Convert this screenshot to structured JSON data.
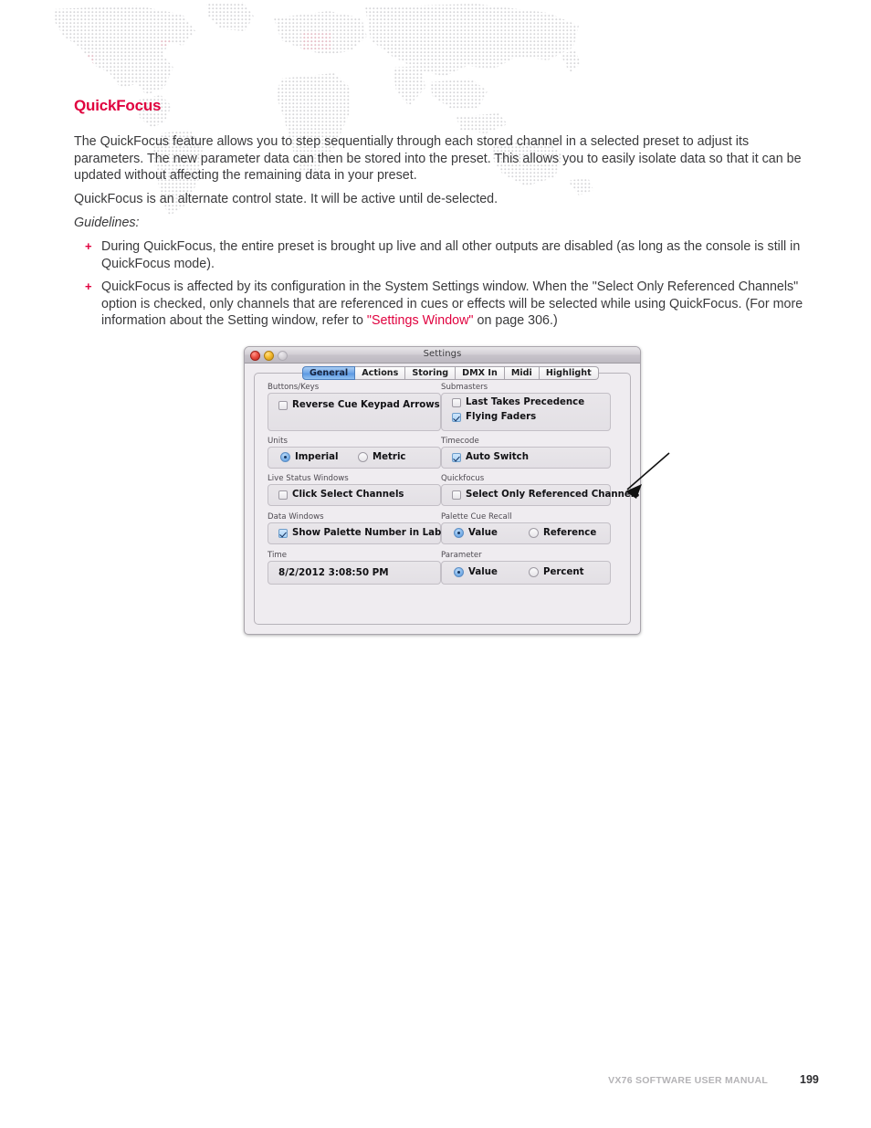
{
  "document": {
    "heading": "QuickFocus",
    "heading_color": "#e0023f",
    "paragraphs": [
      "The QuickFocus feature allows you to step sequentially through each stored channel in a selected preset to adjust its parameters. The new parameter data can then be stored into the preset. This allows you to easily isolate data so that it can be updated without affecting the remaining data in your preset.",
      "QuickFocus is an alternate control state. It will be active until de-selected."
    ],
    "guidelines_label": "Guidelines:",
    "bullet_marker": "+",
    "bullets": [
      {
        "text": "During QuickFocus, the entire preset is brought up live and all other outputs are disabled (as long as the console is still in QuickFocus mode)."
      },
      {
        "text_before": "QuickFocus is affected by its configuration in the System Settings window. When the \"Select Only Referenced Channels\" option is checked, only channels that are referenced in cues or effects will be selected while using QuickFocus. (For more information about the Setting window, refer to ",
        "link": "\"Settings Window\"",
        "text_after": " on page 306.)"
      }
    ]
  },
  "dialog": {
    "title": "Settings",
    "window_buttons": [
      "close-red",
      "minimize-yellow",
      "zoom-gray"
    ],
    "tabs": [
      {
        "label": "General",
        "active": true
      },
      {
        "label": "Actions",
        "active": false
      },
      {
        "label": "Storing",
        "active": false
      },
      {
        "label": "DMX In",
        "active": false
      },
      {
        "label": "Midi",
        "active": false
      },
      {
        "label": "Highlight",
        "active": false
      }
    ],
    "groups": {
      "buttons_keys": {
        "label": "Buttons/Keys",
        "items": [
          {
            "label": "Reverse Cue Keypad Arrows",
            "checked": false
          }
        ]
      },
      "submasters": {
        "label": "Submasters",
        "items": [
          {
            "label": "Last Takes Precedence",
            "checked": false
          },
          {
            "label": "Flying Faders",
            "checked": true
          }
        ]
      },
      "units": {
        "label": "Units",
        "options": [
          {
            "label": "Imperial",
            "selected": true
          },
          {
            "label": "Metric",
            "selected": false
          }
        ]
      },
      "timecode": {
        "label": "Timecode",
        "items": [
          {
            "label": "Auto Switch",
            "checked": true
          }
        ]
      },
      "live_status_windows": {
        "label": "Live Status Windows",
        "items": [
          {
            "label": "Click Select Channels",
            "checked": false
          }
        ]
      },
      "quickfocus": {
        "label": "Quickfocus",
        "items": [
          {
            "label": "Select Only Referenced Channels",
            "checked": false
          }
        ]
      },
      "data_windows": {
        "label": "Data Windows",
        "items": [
          {
            "label": "Show Palette Number in Label",
            "checked": true
          }
        ]
      },
      "palette_cue_recall": {
        "label": "Palette Cue Recall",
        "options": [
          {
            "label": "Value",
            "selected": true
          },
          {
            "label": "Reference",
            "selected": false
          }
        ]
      },
      "time": {
        "label": "Time",
        "value": "8/2/2012 3:08:50 PM"
      },
      "parameter": {
        "label": "Parameter",
        "options": [
          {
            "label": "Value",
            "selected": true
          },
          {
            "label": "Percent",
            "selected": false
          }
        ]
      }
    }
  },
  "annotation": {
    "arrow": "callout-arrow pointing to Quickfocus group"
  },
  "footer": {
    "manual_title": "VX76 SOFTWARE USER MANUAL",
    "page_number": "199"
  }
}
